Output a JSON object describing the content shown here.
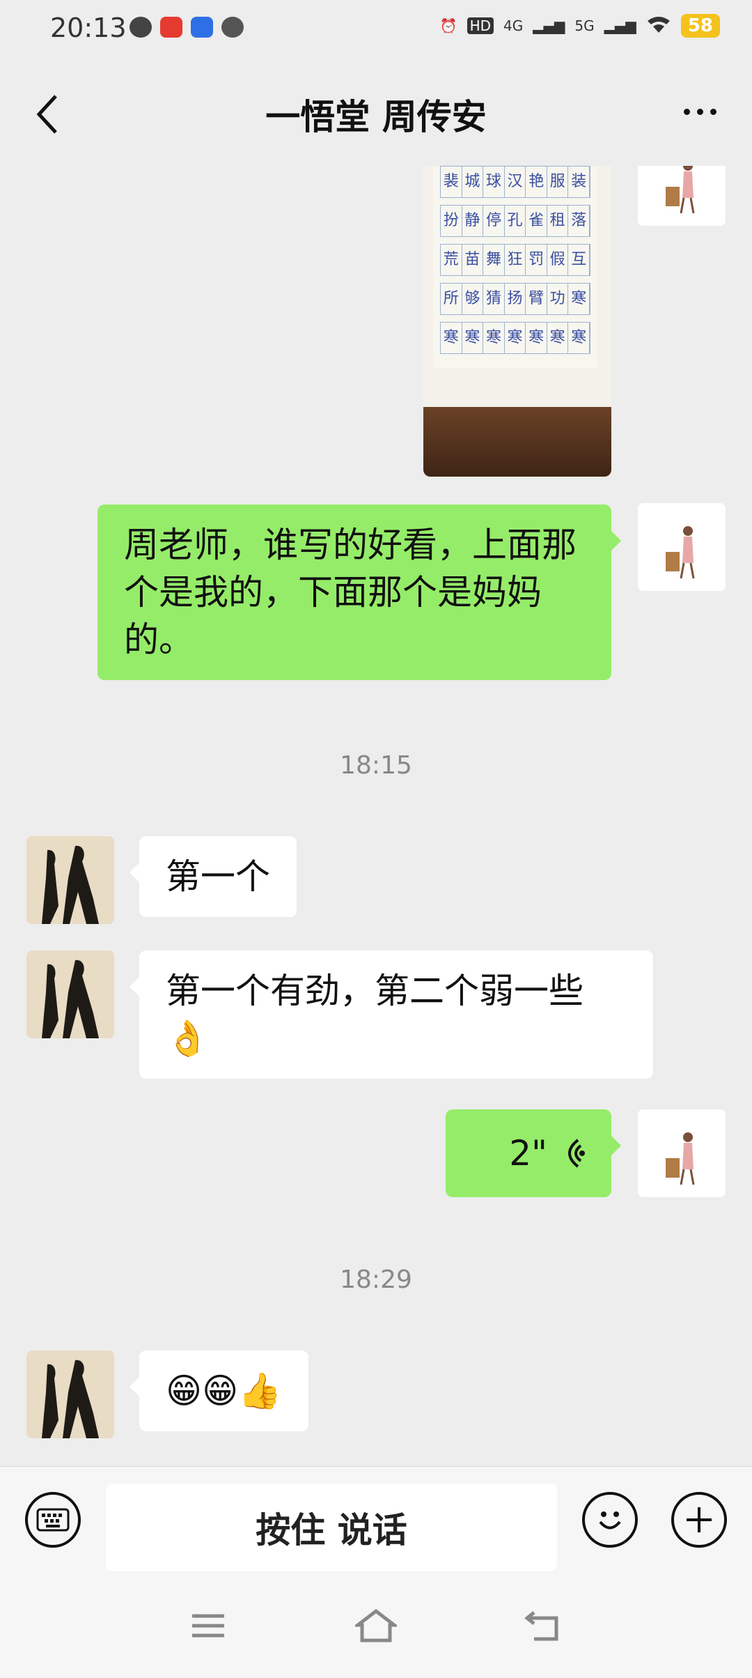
{
  "status_bar": {
    "time": "20:13",
    "battery": "58",
    "network_a": "4G",
    "network_b": "5G",
    "hd": "HD"
  },
  "header": {
    "title": "一悟堂 周传安"
  },
  "messages": {
    "photo": {
      "chars": [
        [
          "裴",
          "城",
          "球",
          "汉",
          "艳",
          "服",
          "装"
        ],
        [
          "扮",
          "静",
          "停",
          "孔",
          "雀",
          "租",
          "落"
        ],
        [
          "荒",
          "苗",
          "舞",
          "狂",
          "罚",
          "假",
          "互"
        ],
        [
          "所",
          "够",
          "猜",
          "扬",
          "臂",
          "功",
          "寒"
        ],
        [
          "寒",
          "寒",
          "寒",
          "寒",
          "寒",
          "寒",
          "寒"
        ]
      ]
    },
    "msg_me_1": "周老师，谁写的好看，上面那个是我的，下面那个是妈妈的。",
    "ts_1": "18:15",
    "msg_them_1": "第一个",
    "msg_them_2": "第一个有劲，第二个弱一些👌",
    "voice_duration": "2\"",
    "ts_2": "18:29",
    "msg_them_3": "😁😁👍"
  },
  "input_bar": {
    "hold_to_talk": "按住 说话"
  },
  "icons": {
    "back": "back-arrow-icon",
    "more": "more-dots-icon",
    "keyboard": "keyboard-icon",
    "emoji": "emoji-icon",
    "plus": "plus-icon"
  },
  "colors": {
    "my_bubble": "#95ec69",
    "their_bubble": "#ffffff",
    "background": "#ededed"
  }
}
